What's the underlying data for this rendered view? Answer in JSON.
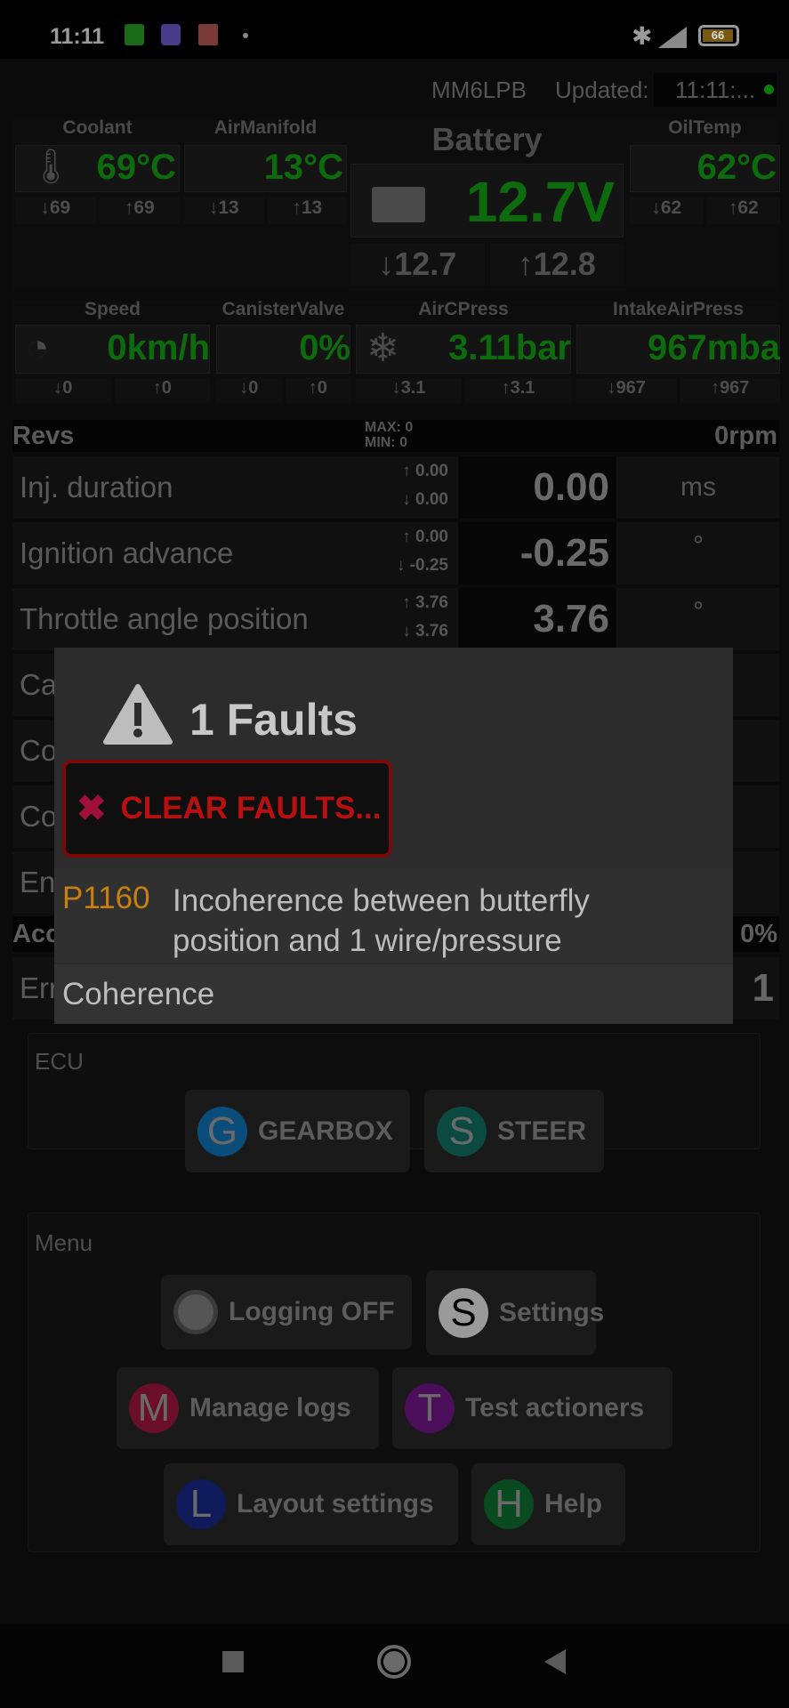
{
  "status_bar": {
    "time": "11:11",
    "battery": "66",
    "icons": [
      "bluetooth-icon",
      "signal-icon",
      "battery-icon"
    ]
  },
  "header": {
    "profile": "MM6LPB",
    "updated_label": "Updated:",
    "updated_time": "11:11:...",
    "status_color": "#0a8a0a"
  },
  "gauges_row1": [
    {
      "label": "Coolant",
      "value": "69°C",
      "min": "69",
      "max": "69",
      "icon": "thermometer-icon"
    },
    {
      "label": "AirManifold",
      "value": "13°C",
      "min": "13",
      "max": "13"
    },
    {
      "label": "Battery",
      "value": "12.7V",
      "min": "12.7",
      "max": "12.8",
      "icon": "battery-icon"
    },
    {
      "label": "OilTemp",
      "value": "62°C",
      "min": "62",
      "max": "62"
    }
  ],
  "gauges_row2": [
    {
      "label": "Speed",
      "value": "0km/h",
      "min": "0",
      "max": "0",
      "icon": "speedometer-icon"
    },
    {
      "label": "CanisterValve",
      "value": "0%",
      "min": "0",
      "max": "0"
    },
    {
      "label": "AirCPress",
      "value": "3.11bar",
      "min": "3.1",
      "max": "3.1",
      "icon": "snowflake-icon"
    },
    {
      "label": "IntakeAirPress",
      "value": "967mba",
      "min": "967",
      "max": "967"
    }
  ],
  "revs": {
    "label": "Revs",
    "max": "MAX: 0",
    "min": "MIN: 0",
    "value": "0rpm"
  },
  "params": [
    {
      "label": "Inj. duration",
      "max": "0.00",
      "min": "0.00",
      "value": "0.00",
      "unit": "ms"
    },
    {
      "label": "Ignition advance",
      "max": "0.00",
      "min": "-0.25",
      "value": "-0.25",
      "unit": "°"
    },
    {
      "label": "Throttle angle position",
      "max": "3.76",
      "min": "3.76",
      "value": "3.76",
      "unit": "°"
    }
  ],
  "hidden_rows": [
    "Ca",
    "Co",
    "Co",
    "En"
  ],
  "acc_header": {
    "label": "Acc",
    "value": "0%"
  },
  "err_row": {
    "label": "Err",
    "value": "1"
  },
  "dialog": {
    "title": "1 Faults",
    "clear_label": "CLEAR FAULTS...",
    "faults": [
      {
        "code": "P1160",
        "description": "Incoherence between butterfly position and 1 wire/pressure"
      }
    ],
    "category": "Coherence",
    "code_color": "#d08a10",
    "clear_color": "#c81010"
  },
  "ecu": {
    "title": "ECU",
    "buttons": [
      {
        "letter": "G",
        "label": "GEARBOX",
        "color": "#0a4d7a"
      },
      {
        "letter": "S",
        "label": "STEER",
        "color": "#0a4a40"
      }
    ]
  },
  "menu": {
    "title": "Menu",
    "buttons": [
      {
        "letter": "",
        "label": "Logging OFF",
        "color": "#555555"
      },
      {
        "letter": "S",
        "label": "Settings",
        "color": "#9a9a9a"
      },
      {
        "letter": "M",
        "label": "Manage logs",
        "color": "#6a0e2a"
      },
      {
        "letter": "T",
        "label": "Test actioners",
        "color": "#4a0e5a"
      },
      {
        "letter": "L",
        "label": "Layout settings",
        "color": "#0e1a5a"
      },
      {
        "letter": "H",
        "label": "Help",
        "color": "#0a4a20"
      }
    ]
  }
}
